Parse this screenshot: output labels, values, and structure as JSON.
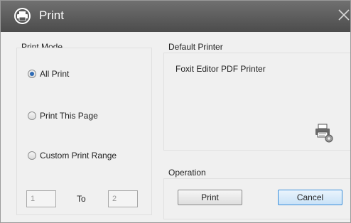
{
  "window": {
    "title": "Print",
    "app_icon": "print-icon",
    "close_icon": "close-icon"
  },
  "print_mode": {
    "label": "Print Mode",
    "options": [
      {
        "label": "All Print",
        "checked": true
      },
      {
        "label": "Print This Page",
        "checked": false
      },
      {
        "label": "Custom Print Range",
        "checked": false
      }
    ],
    "range_from": "1",
    "range_to_label": "To",
    "range_to": "2"
  },
  "default_printer": {
    "label": "Default Printer",
    "name": "Foxit Editor PDF Printer",
    "settings_icon": "printer-settings-icon"
  },
  "operation": {
    "label": "Operation",
    "print_button": "Print",
    "cancel_button": "Cancel"
  },
  "colors": {
    "titlebar": "#5a5a5a",
    "accent": "#3a8edb",
    "background": "#f0f0f0"
  }
}
